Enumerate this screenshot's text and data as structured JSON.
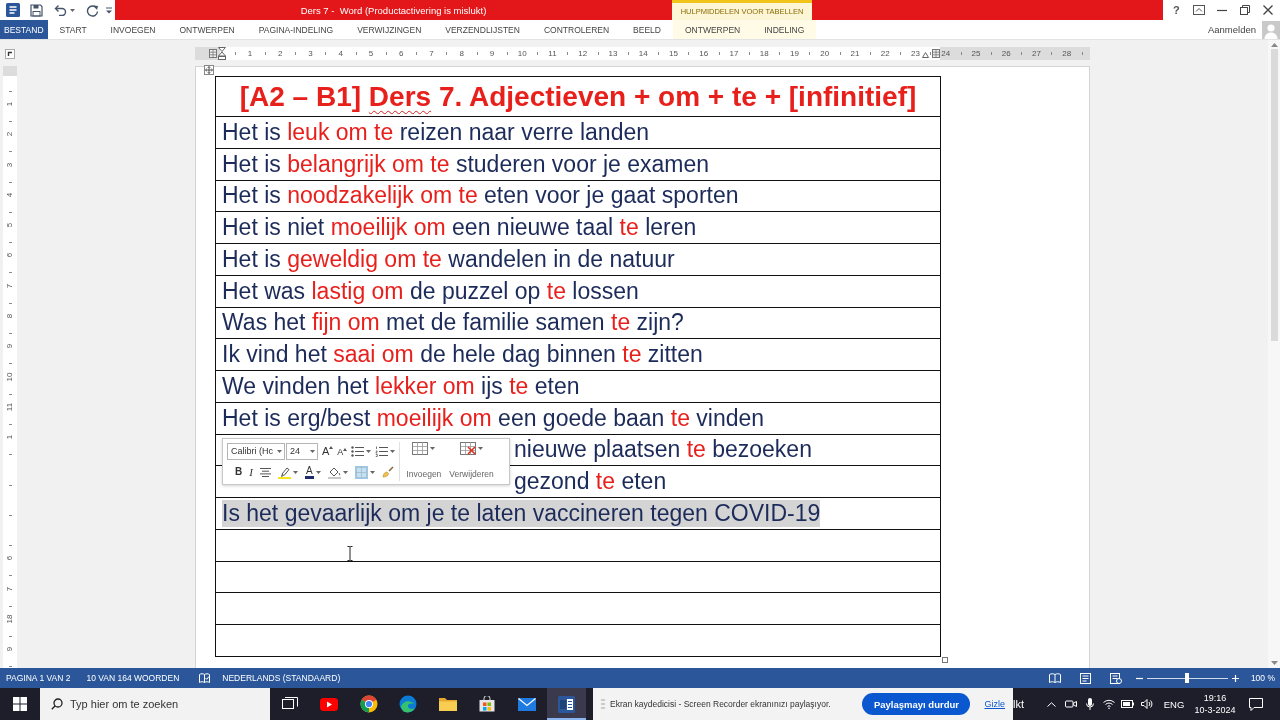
{
  "title_bar": {
    "title": "Ders 7 -  Word (Productactivering is mislukt)",
    "table_tools": "HULPMIDDELEN VOOR TABELLEN",
    "help": "?"
  },
  "ribbon_tabs": [
    {
      "label": "BESTAND",
      "kind": "file",
      "selected": false
    },
    {
      "label": "START",
      "kind": "tab",
      "selected": false
    },
    {
      "label": "INVOEGEN",
      "kind": "tab",
      "selected": false
    },
    {
      "label": "ONTWERPEN",
      "kind": "tab",
      "selected": false
    },
    {
      "label": "PAGINA-INDELING",
      "kind": "tab",
      "selected": false
    },
    {
      "label": "VERWIJZINGEN",
      "kind": "tab",
      "selected": false
    },
    {
      "label": "VERZENDLIJSTEN",
      "kind": "tab",
      "selected": false
    },
    {
      "label": "CONTROLEREN",
      "kind": "tab",
      "selected": false
    },
    {
      "label": "BEELD",
      "kind": "tab",
      "selected": false
    },
    {
      "label": "ONTWERPEN",
      "kind": "contextual",
      "selected": false
    },
    {
      "label": "INDELING",
      "kind": "contextual",
      "selected": false
    }
  ],
  "account": {
    "label": "Aanmelden"
  },
  "horizontal_ruler": {
    "labels": [
      "1",
      "2",
      "3",
      "4",
      "5",
      "6",
      "7",
      "8",
      "9",
      "10",
      "11",
      "12",
      "13",
      "14",
      "15",
      "16",
      "17",
      "18",
      "19",
      "20",
      "21",
      "22",
      "23",
      "24",
      "25",
      "26",
      "27",
      "28"
    ]
  },
  "vertical_ruler": {
    "marks": [
      {
        "kind": "number",
        "label": "1"
      },
      {
        "kind": "number",
        "label": "2"
      },
      {
        "kind": "number",
        "label": "3"
      },
      {
        "kind": "number",
        "label": "4"
      },
      {
        "kind": "number",
        "label": "5"
      },
      {
        "kind": "number",
        "label": "6"
      },
      {
        "kind": "number",
        "label": "7"
      },
      {
        "kind": "number",
        "label": "8"
      },
      {
        "kind": "number",
        "label": "9"
      },
      {
        "kind": "number",
        "label": "10"
      },
      {
        "kind": "number",
        "label": "11"
      },
      {
        "kind": "number",
        "label": "1"
      },
      {
        "kind": "tick"
      },
      {
        "kind": "tick"
      },
      {
        "kind": "tick"
      },
      {
        "kind": "number",
        "label": "6"
      },
      {
        "kind": "number",
        "label": "7"
      },
      {
        "kind": "number",
        "label": "18"
      },
      {
        "kind": "number",
        "label": "9"
      }
    ]
  },
  "table": {
    "title": [
      {
        "text": "[A2 – B1] ",
        "misspelled": false
      },
      {
        "text": "Ders",
        "misspelled": true
      },
      {
        "text": " 7. Adjectieven + om + te + [infinitief]",
        "misspelled": false
      }
    ],
    "rows": [
      {
        "kind": "text",
        "selected": false,
        "segments": [
          {
            "text": "Het is ",
            "emphasis": false
          },
          {
            "text": "leuk om te",
            "emphasis": true
          },
          {
            "text": " reizen naar verre landen",
            "emphasis": false
          }
        ]
      },
      {
        "kind": "text",
        "selected": false,
        "segments": [
          {
            "text": "Het is ",
            "emphasis": false
          },
          {
            "text": "belangrijk om te",
            "emphasis": true
          },
          {
            "text": " studeren voor je examen",
            "emphasis": false
          }
        ]
      },
      {
        "kind": "text",
        "selected": false,
        "segments": [
          {
            "text": "Het is ",
            "emphasis": false
          },
          {
            "text": "noodzakelijk om te",
            "emphasis": true
          },
          {
            "text": " eten voor je gaat sporten",
            "emphasis": false
          }
        ]
      },
      {
        "kind": "text",
        "selected": false,
        "segments": [
          {
            "text": "Het is niet ",
            "emphasis": false
          },
          {
            "text": "moeilijk om",
            "emphasis": true
          },
          {
            "text": " een nieuwe taal ",
            "emphasis": false
          },
          {
            "text": "te",
            "emphasis": true
          },
          {
            "text": " leren",
            "emphasis": false
          }
        ]
      },
      {
        "kind": "text",
        "selected": false,
        "segments": [
          {
            "text": "Het is ",
            "emphasis": false
          },
          {
            "text": "geweldig om te",
            "emphasis": true
          },
          {
            "text": " wandelen in de natuur",
            "emphasis": false
          }
        ]
      },
      {
        "kind": "text",
        "selected": false,
        "segments": [
          {
            "text": "Het was ",
            "emphasis": false
          },
          {
            "text": "lastig om",
            "emphasis": true
          },
          {
            "text": " de puzzel op ",
            "emphasis": false
          },
          {
            "text": "te",
            "emphasis": true
          },
          {
            "text": " lossen",
            "emphasis": false
          }
        ]
      },
      {
        "kind": "text",
        "selected": false,
        "segments": [
          {
            "text": "Was het ",
            "emphasis": false
          },
          {
            "text": "fijn om",
            "emphasis": true
          },
          {
            "text": " met de familie samen ",
            "emphasis": false
          },
          {
            "text": "te",
            "emphasis": true
          },
          {
            "text": " zijn?",
            "emphasis": false
          }
        ]
      },
      {
        "kind": "text",
        "selected": false,
        "segments": [
          {
            "text": "Ik vind het ",
            "emphasis": false
          },
          {
            "text": "saai om",
            "emphasis": true
          },
          {
            "text": " de hele dag binnen ",
            "emphasis": false
          },
          {
            "text": "te",
            "emphasis": true
          },
          {
            "text": " zitten",
            "emphasis": false
          }
        ]
      },
      {
        "kind": "text",
        "selected": false,
        "segments": [
          {
            "text": "We vinden het ",
            "emphasis": false
          },
          {
            "text": "lekker om",
            "emphasis": true
          },
          {
            "text": " ijs ",
            "emphasis": false
          },
          {
            "text": "te",
            "emphasis": true
          },
          {
            "text": " eten",
            "emphasis": false
          }
        ]
      },
      {
        "kind": "text",
        "selected": false,
        "segments": [
          {
            "text": "Het is erg/best ",
            "emphasis": false
          },
          {
            "text": "moeilijk om",
            "emphasis": true
          },
          {
            "text": " een goede baan ",
            "emphasis": false
          },
          {
            "text": "te",
            "emphasis": true
          },
          {
            "text": " vinden",
            "emphasis": false
          }
        ]
      },
      {
        "kind": "covered",
        "selected": false,
        "segments": [
          {
            "text": "nieuwe plaatsen ",
            "emphasis": false
          },
          {
            "text": "te",
            "emphasis": true
          },
          {
            "text": " bezoeken",
            "emphasis": false
          }
        ]
      },
      {
        "kind": "covered",
        "selected": false,
        "segments": [
          {
            "text": "gezond ",
            "emphasis": false
          },
          {
            "text": "te",
            "emphasis": true
          },
          {
            "text": " eten",
            "emphasis": false
          }
        ]
      },
      {
        "kind": "text",
        "selected": true,
        "segments": [
          {
            "text": "Is het gevaarlijk om je te laten vaccineren tegen COVID-19",
            "emphasis": false
          }
        ]
      },
      {
        "kind": "empty",
        "selected": false
      },
      {
        "kind": "empty",
        "selected": false
      },
      {
        "kind": "empty",
        "selected": false
      },
      {
        "kind": "empty",
        "selected": false
      }
    ]
  },
  "mini_toolbar": {
    "font": "Calibri (Hc",
    "size": "24",
    "grow_font": "A",
    "shrink_font": "A",
    "bold": "B",
    "italic": "I",
    "font_color": "A",
    "borders_active": true,
    "insert": "Invoegen",
    "delete": "Verwijderen"
  },
  "status_bar": {
    "page": "PAGINA 1 VAN 2",
    "words": "10 VAN 164 WOORDEN",
    "language": "NEDERLANDS (STANDAARD)",
    "zoom": {
      "level": 0.5,
      "reading": "100 %"
    }
  },
  "taskbar": {
    "search": {
      "placeholder": "Typ hier om te zoeken"
    },
    "apps": [
      {
        "kind": "taskview",
        "active": false
      },
      {
        "kind": "video",
        "active": false
      },
      {
        "kind": "chrome",
        "active": false
      },
      {
        "kind": "edge",
        "active": false
      },
      {
        "kind": "folder",
        "active": false
      },
      {
        "kind": "store",
        "active": false
      },
      {
        "kind": "mail",
        "active": false
      },
      {
        "kind": "word",
        "active": true
      }
    ],
    "share_banner": {
      "message": "Ekran kaydedicisi - Screen Recorder ekranınızı paylaşıyor.",
      "stop_button": "Paylaşmayı durdur",
      "hide_link": "Gizle"
    },
    "partial_text": "lkt",
    "language": "ENG",
    "time": "19:16",
    "date": "10-3-2024"
  }
}
